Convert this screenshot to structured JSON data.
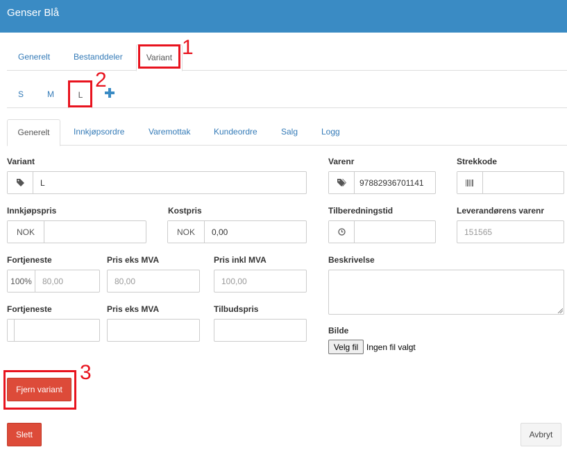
{
  "header": {
    "title": "Genser Blå"
  },
  "main_tabs": [
    "Generelt",
    "Bestanddeler",
    "Variant"
  ],
  "variant_tabs": [
    "S",
    "M",
    "L"
  ],
  "sub_tabs": [
    "Generelt",
    "Innkjøpsordre",
    "Varemottak",
    "Kundeordre",
    "Salg",
    "Logg"
  ],
  "form": {
    "variant": {
      "label": "Variant",
      "value": "L"
    },
    "varenr": {
      "label": "Varenr",
      "value": "97882936701141"
    },
    "strekkode": {
      "label": "Strekkode",
      "value": ""
    },
    "innkjopspris": {
      "label": "Innkjøpspris",
      "currency": "NOK",
      "value": ""
    },
    "kostpris": {
      "label": "Kostpris",
      "currency": "NOK",
      "value": "0,00"
    },
    "tilberedningstid": {
      "label": "Tilberedningstid",
      "value": ""
    },
    "leverandor_varenr": {
      "label": "Leverandørens varenr",
      "placeholder": "151565"
    },
    "fortjeneste1": {
      "label": "Fortjeneste",
      "percent": "100%",
      "placeholder": "80,00"
    },
    "pris_eks_mva1": {
      "label": "Pris eks MVA",
      "placeholder": "80,00"
    },
    "pris_inkl_mva": {
      "label": "Pris inkl MVA",
      "placeholder": "100,00"
    },
    "beskrivelse": {
      "label": "Beskrivelse",
      "value": ""
    },
    "fortjeneste2": {
      "label": "Fortjeneste",
      "value": ""
    },
    "pris_eks_mva2": {
      "label": "Pris eks MVA",
      "value": ""
    },
    "tilbudspris": {
      "label": "Tilbudspris",
      "value": ""
    },
    "bilde": {
      "label": "Bilde",
      "button": "Velg fil",
      "status": "Ingen fil valgt"
    }
  },
  "buttons": {
    "remove_variant": "Fjern variant",
    "delete": "Slett",
    "cancel": "Avbryt"
  },
  "annotations": [
    "1",
    "2",
    "3"
  ],
  "colors": {
    "header": "#3a8bc4",
    "danger": "#dd4b39",
    "marker": "#e8131e",
    "link": "#337ab7"
  }
}
